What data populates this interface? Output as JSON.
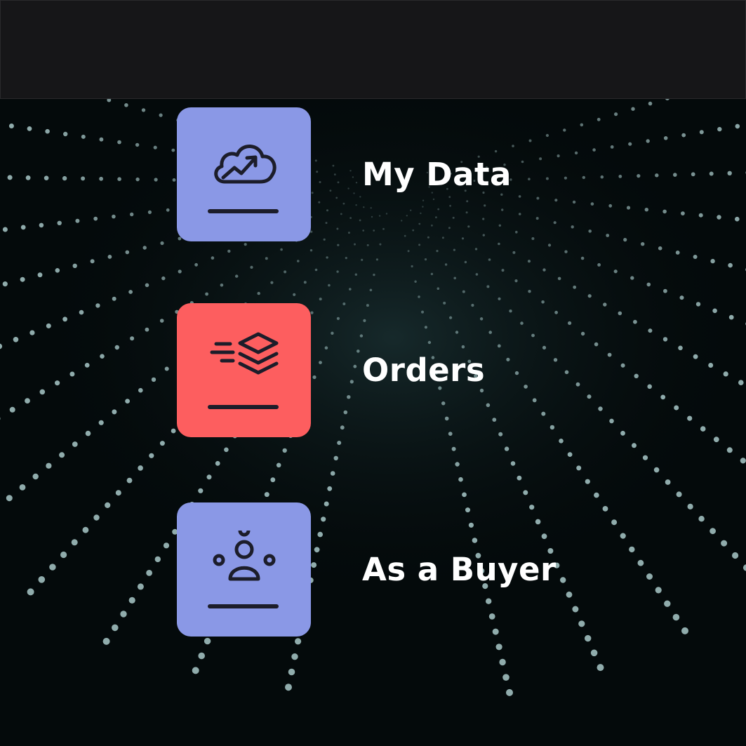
{
  "colors": {
    "top_bar": "#161618",
    "background": "#040a0b",
    "tile_blue": "#8a98e6",
    "tile_red": "#fd5e5f",
    "icon_stroke": "#1c1d2a",
    "label": "#ffffff",
    "particle": "#bfe3e3"
  },
  "menu": {
    "items": [
      {
        "label": "My Data",
        "icon": "cloud-growth-icon",
        "tile_color": "#8a98e6"
      },
      {
        "label": "Orders",
        "icon": "layers-fast-icon",
        "tile_color": "#fd5e5f"
      },
      {
        "label": "As a Buyer",
        "icon": "buyer-network-icon",
        "tile_color": "#8a98e6"
      }
    ]
  }
}
